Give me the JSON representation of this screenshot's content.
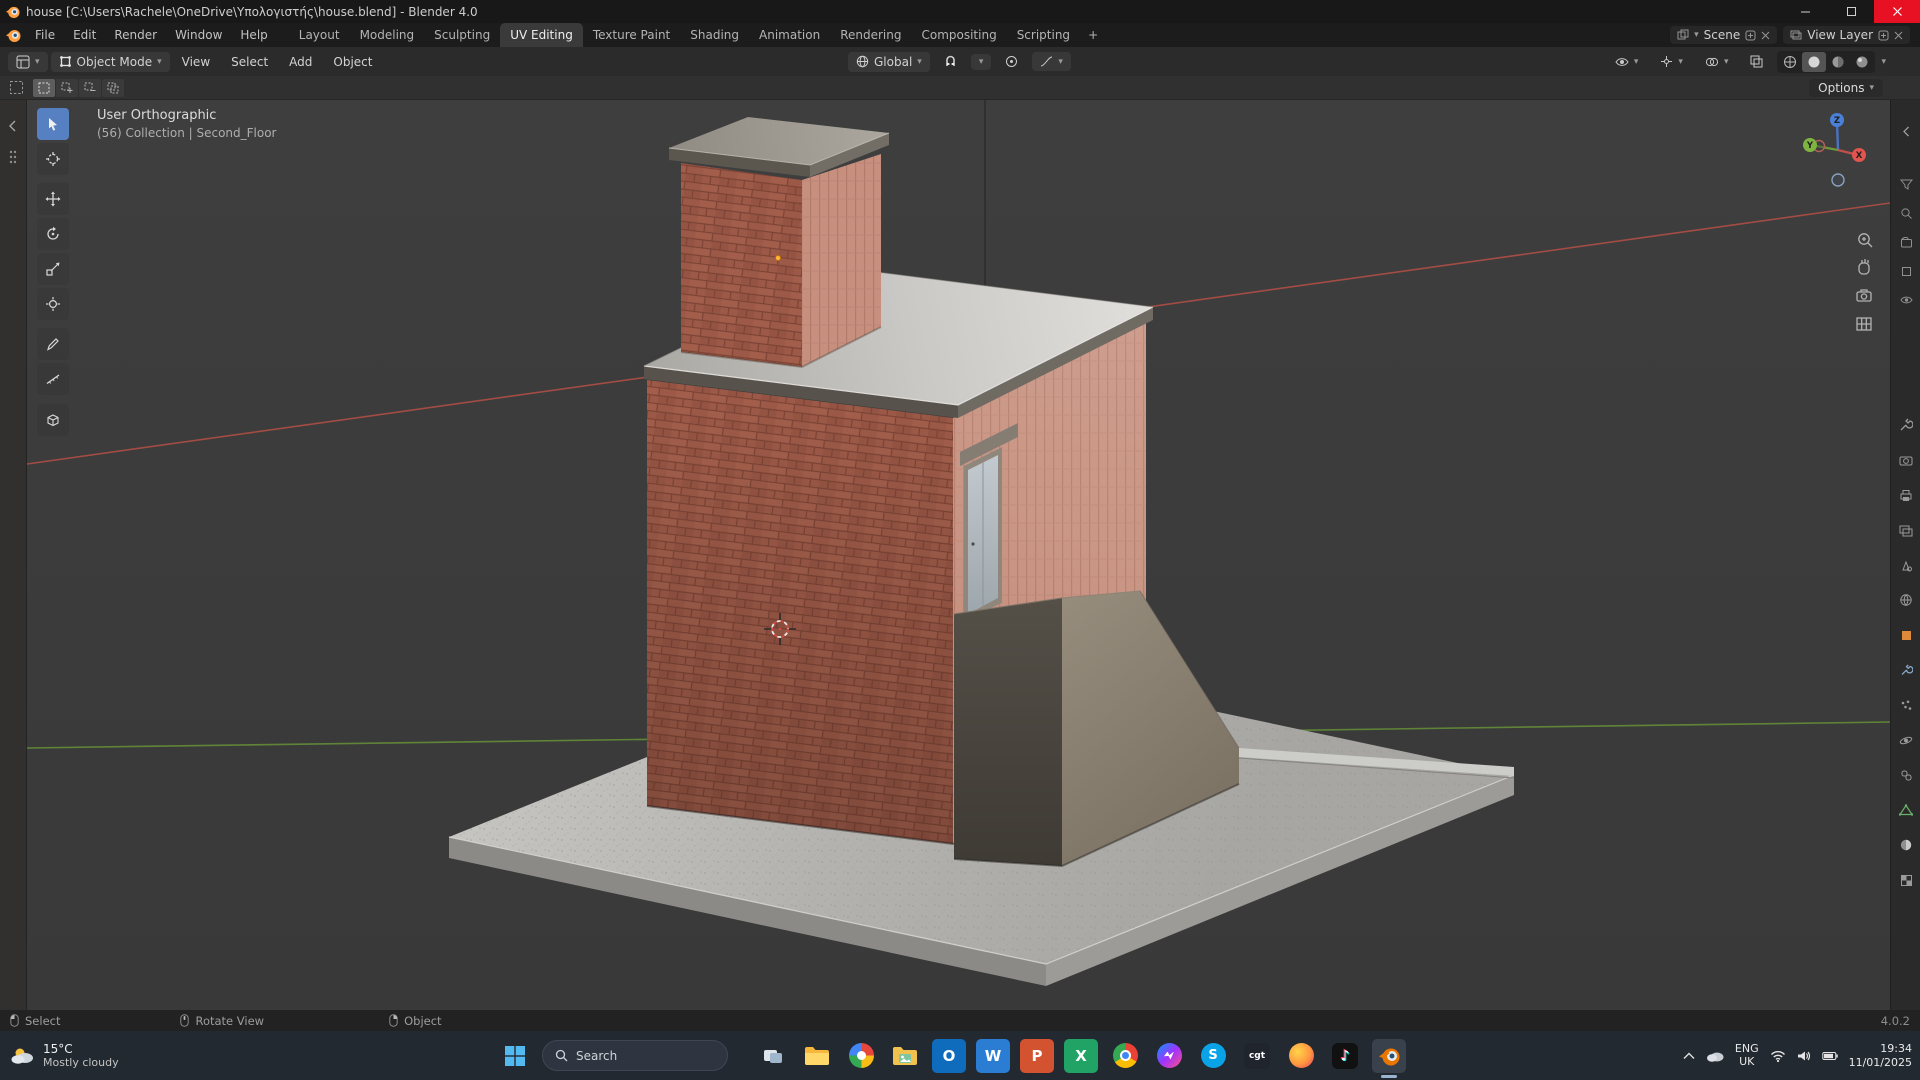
{
  "window": {
    "title": "house [C:\\Users\\Rachele\\OneDrive\\Υπολογιστής\\house.blend] - Blender 4.0"
  },
  "menu_bar": {
    "menus": [
      {
        "label": "File"
      },
      {
        "label": "Edit"
      },
      {
        "label": "Render"
      },
      {
        "label": "Window"
      },
      {
        "label": "Help"
      }
    ],
    "workspaces": [
      {
        "label": "Layout",
        "active": false
      },
      {
        "label": "Modeling",
        "active": false
      },
      {
        "label": "Sculpting",
        "active": false
      },
      {
        "label": "UV Editing",
        "active": true
      },
      {
        "label": "Texture Paint",
        "active": false
      },
      {
        "label": "Shading",
        "active": false
      },
      {
        "label": "Animation",
        "active": false
      },
      {
        "label": "Rendering",
        "active": false
      },
      {
        "label": "Compositing",
        "active": false
      },
      {
        "label": "Scripting",
        "active": false
      }
    ],
    "add_workspace_label": "+",
    "scene": {
      "label": "Scene"
    },
    "view_layer": {
      "label": "View Layer"
    }
  },
  "tool_header": {
    "mode_label": "Object Mode",
    "menus": [
      {
        "label": "View"
      },
      {
        "label": "Select"
      },
      {
        "label": "Add"
      },
      {
        "label": "Object"
      }
    ],
    "orientation_label": "Global",
    "options_label": "Options"
  },
  "viewport": {
    "overlay_line1": "User Orthographic",
    "overlay_line2": "(56) Collection | Second_Floor",
    "gizmo_axes": {
      "x": "X",
      "y": "Y",
      "z": "Z"
    },
    "toolbar_tools": [
      "select-box",
      "cursor",
      "move",
      "rotate",
      "scale",
      "transform",
      "annotate",
      "measure",
      "add-cube"
    ]
  },
  "properties_tabs": [
    "tool",
    "render",
    "output",
    "view-layer",
    "scene",
    "world",
    "object",
    "modifiers",
    "particles",
    "physics",
    "constraints",
    "object-data",
    "material",
    "texture"
  ],
  "status_bar": {
    "hints": [
      {
        "label": "Select"
      },
      {
        "label": "Rotate View"
      },
      {
        "label": "Object"
      }
    ],
    "version": "4.0.2"
  },
  "taskbar": {
    "weather": {
      "temp": "15°C",
      "desc": "Mostly cloudy"
    },
    "search_label": "Search",
    "apps": [
      {
        "name": "task-view"
      },
      {
        "name": "file-explorer"
      },
      {
        "name": "photos"
      },
      {
        "name": "gallery"
      },
      {
        "name": "outlook",
        "glyph": "O"
      },
      {
        "name": "word",
        "glyph": "W"
      },
      {
        "name": "powerpoint",
        "glyph": "P"
      },
      {
        "name": "excel",
        "glyph": "X"
      },
      {
        "name": "chrome"
      },
      {
        "name": "messenger"
      },
      {
        "name": "skype",
        "glyph": "S"
      },
      {
        "name": "cgtrader",
        "glyph": "cgt"
      },
      {
        "name": "firefox"
      },
      {
        "name": "tiktok",
        "glyph": "♪"
      },
      {
        "name": "blender",
        "active": true
      }
    ],
    "tray": {
      "language": "ENG",
      "region": "UK",
      "time": "19:34",
      "date": "11/01/2025"
    }
  },
  "colors": {
    "blender_orange": "#ea7600",
    "active_tool_blue": "#5680c2",
    "axis_x_red": "#a34c44",
    "axis_y_green": "#5f8437",
    "brick_dark": "#9c5947",
    "brick_light": "#c68f7e",
    "concrete_light": "#bcbbb7",
    "viewport_bg": "#3c3c3c",
    "header_bg": "#2b2b2b",
    "taskbar_bg": "#232931"
  }
}
